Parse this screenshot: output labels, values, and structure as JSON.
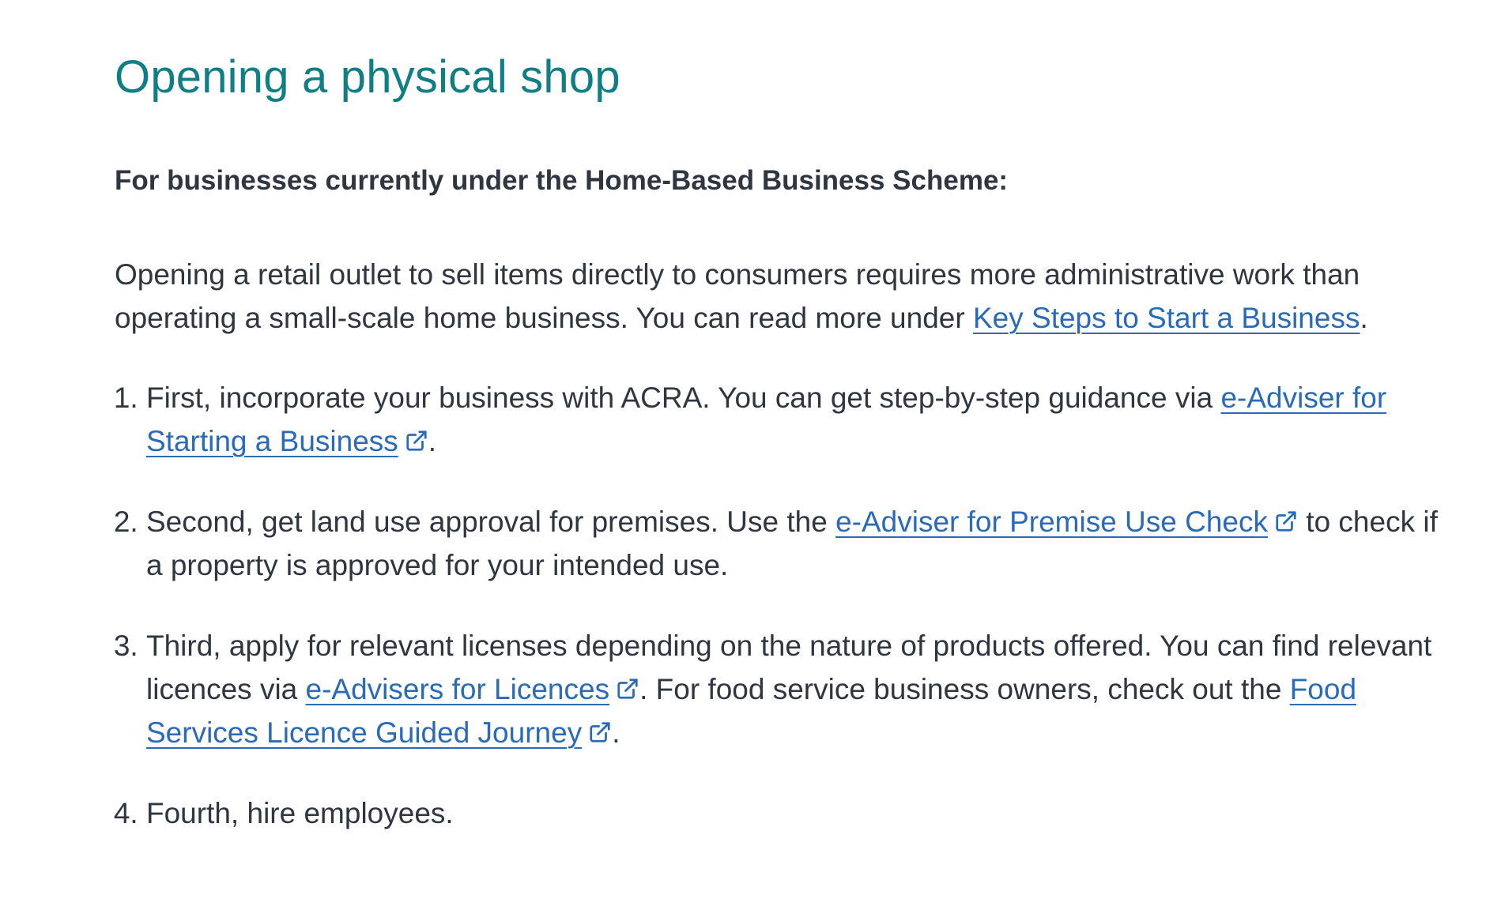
{
  "page": {
    "title": "Opening a physical shop",
    "subheading": "For businesses currently under the Home-Based Business Scheme:",
    "intro": {
      "text_before": "Opening a retail outlet to sell items directly to consumers requires more administrative work than operating a small-scale home business. You can read more under ",
      "link_label": "Key Steps to Start a Business",
      "text_after": "."
    },
    "steps": [
      {
        "text_before": "First, incorporate your business with ACRA. You can get step-by-step guidance via ",
        "link_label": "e-Adviser for Starting a Business",
        "text_after": "."
      },
      {
        "text_before": "Second, get land use approval for premises. Use the ",
        "link_label": "e-Adviser for Premise Use Check",
        "text_after": " to check if a property is approved for your intended use."
      },
      {
        "text_before": "Third, apply for relevant licenses depending on the nature of products offered. You can find relevant licences via ",
        "link_label": "e-Advisers for Licences",
        "text_middle": ". For food service business owners, check out the ",
        "link2_label": "Food Services Licence Guided Journey",
        "text_after": "."
      },
      {
        "text": "Fourth, hire employees."
      }
    ]
  },
  "icons": {
    "external_link": "external-link-icon"
  },
  "colors": {
    "heading": "#0f7f85",
    "body_text": "#2f3640",
    "link": "#2a6ab8",
    "background": "#ffffff"
  }
}
